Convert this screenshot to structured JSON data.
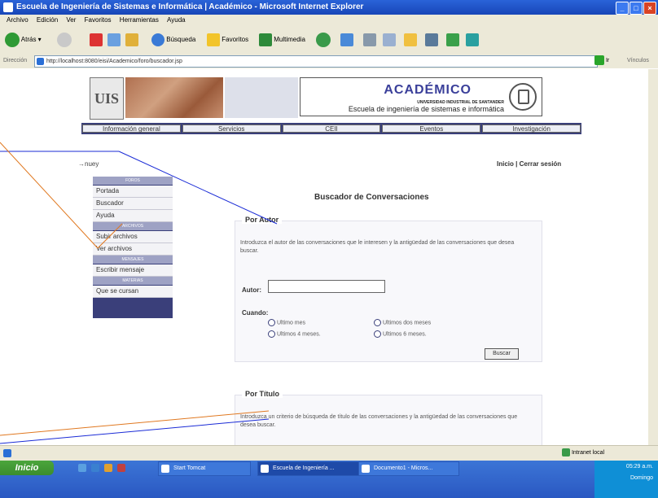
{
  "window": {
    "title": "Escuela de Ingeniería de Sistemas e Informática | Académico - Microsoft Internet Explorer"
  },
  "menu": [
    "Archivo",
    "Edición",
    "Ver",
    "Favoritos",
    "Herramientas",
    "Ayuda"
  ],
  "toolbar": {
    "back": "Atrás",
    "search": "Búsqueda",
    "favorites": "Favoritos",
    "media": "Multimedia"
  },
  "address": {
    "label": "Dirección",
    "url": "http://localhost:8080/eisi/Academico/foro/buscador.jsp",
    "go": "Ir",
    "links": "Vínculos"
  },
  "banner": {
    "logo_text": "UIS",
    "academico": "ACADÉMICO",
    "university": "UNIVERSIDAD INDUSTRIAL DE SANTANDER",
    "school": "Escuela de ingeniería de sistemas e informática"
  },
  "nav": [
    "Información general",
    "Servicios",
    "CEII",
    "Eventos",
    "Investigación"
  ],
  "user": "nuey",
  "top_links": {
    "inicio": "Inicio",
    "sep": "|",
    "logout": "Cerrar sesión"
  },
  "sidebar": {
    "sections": [
      {
        "header": "FOROS",
        "items": [
          "Portada",
          "Buscador",
          "Ayuda"
        ]
      },
      {
        "header": "ARCHIVOS",
        "items": [
          "Subir archivos",
          "Ver archivos"
        ]
      },
      {
        "header": "MENSAJES",
        "items": [
          "Escribir mensaje"
        ]
      },
      {
        "header": "MATERIAS",
        "items": [
          "Que se cursan"
        ]
      }
    ]
  },
  "panel": {
    "title": "Buscador de Conversaciones",
    "por_autor": {
      "legend": "Por Autor",
      "desc": "Introduzca el autor de las conversaciones que le interesen y la antigüedad de las conversaciones que desea buscar.",
      "autor_label": "Autor:",
      "cuando_label": "Cuando:",
      "options": [
        "Ultimo mes",
        "Ultimos dos meses",
        "Ultimos 4 meses.",
        "Ultimos 6 meses."
      ],
      "button": "Buscar"
    },
    "por_titulo": {
      "legend": "Por Título",
      "desc": "Introduzca un criterio de búsqueda de título de las conversaciones y la antigüedad de las conversaciones que desea buscar."
    }
  },
  "status": {
    "zone": "Intranet local"
  },
  "taskbar": {
    "start": "Inicio",
    "tasks": [
      "Start Tomcat",
      "Escuela de Ingeniería ...",
      "Documento1 - Micros..."
    ],
    "time": "05:29 a.m.",
    "day": "Domingo"
  }
}
